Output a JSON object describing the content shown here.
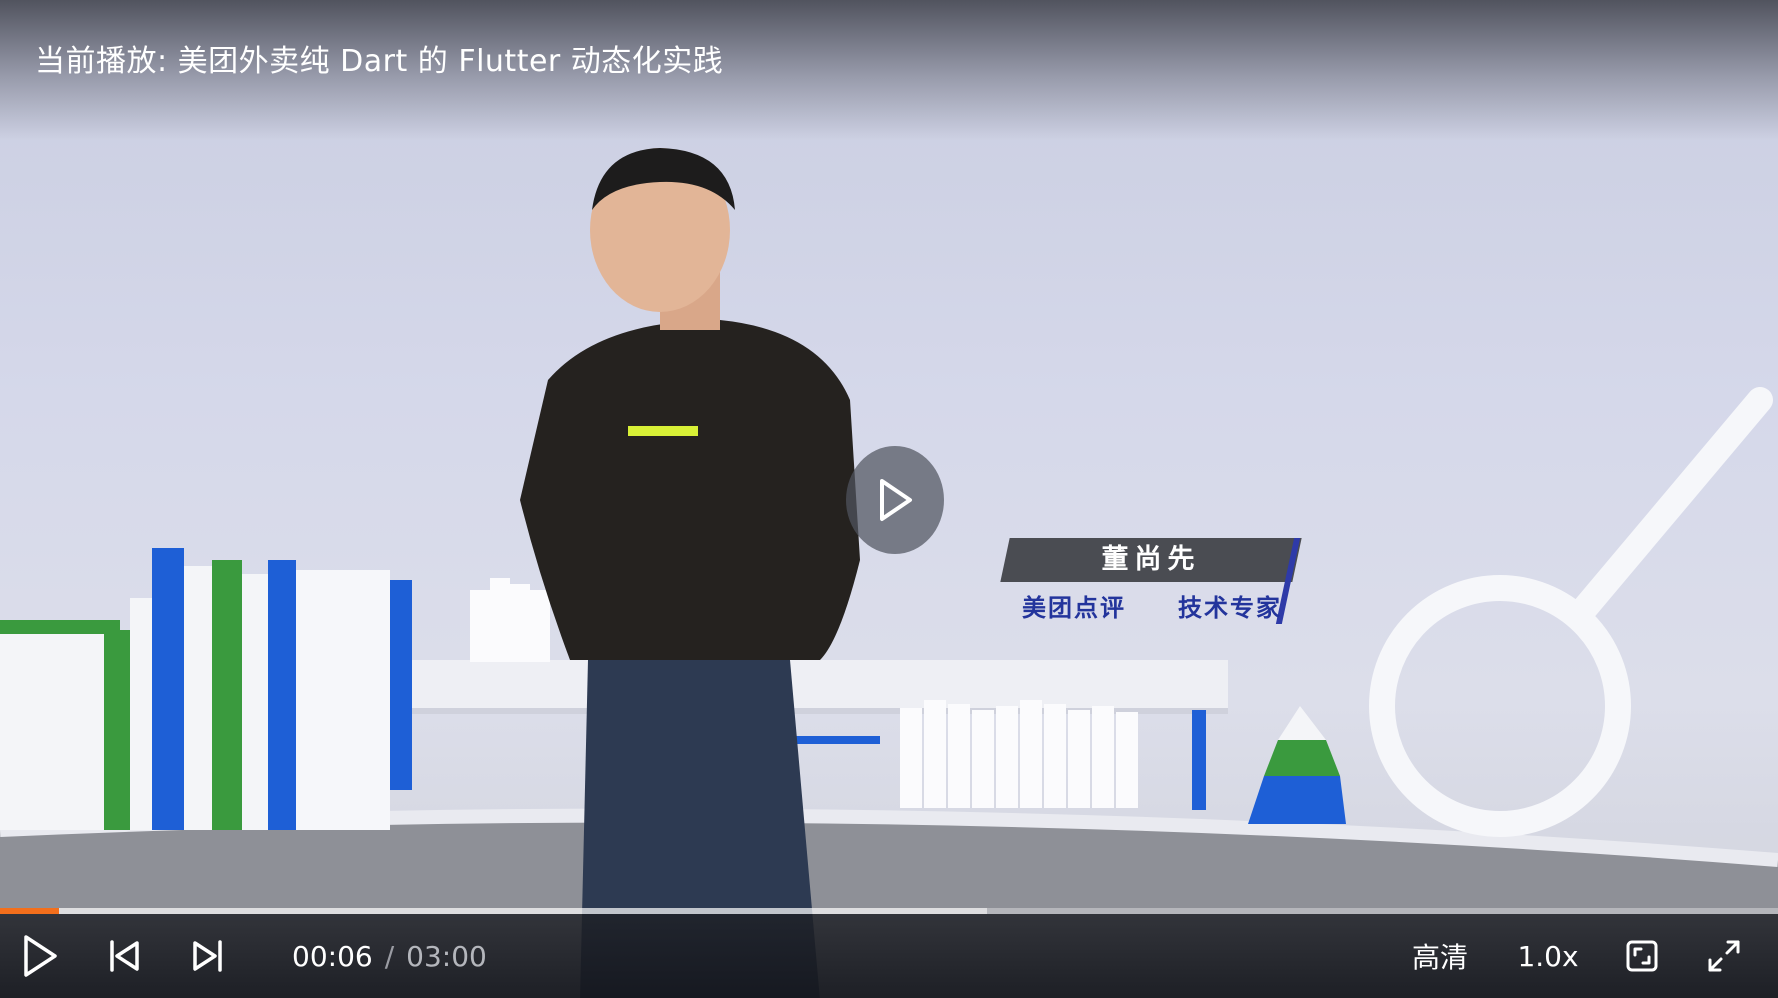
{
  "video": {
    "title": "当前播放: 美团外卖纯 Dart 的 Flutter 动态化实践",
    "lower_third": {
      "name": "董尚先",
      "company": "美团点评",
      "role": "技术专家"
    }
  },
  "controls": {
    "current_time": "00:06",
    "separator": "/",
    "duration": "03:00",
    "progress_fraction": 0.033,
    "buffered_fraction": 0.555,
    "quality_label": "高清",
    "speed_label": "1.0x"
  },
  "icons": {
    "big_play": "play-icon",
    "play": "play-icon",
    "previous": "skip-previous-icon",
    "next": "skip-next-icon",
    "window_fullscreen": "web-fullscreen-icon",
    "fullscreen": "fullscreen-icon"
  },
  "colors": {
    "progress_played": "#f36f1c",
    "lower_third_bg": "#4a4c52",
    "lower_third_accent": "#2e3aa8",
    "lower_third_subtext": "#23349c"
  }
}
